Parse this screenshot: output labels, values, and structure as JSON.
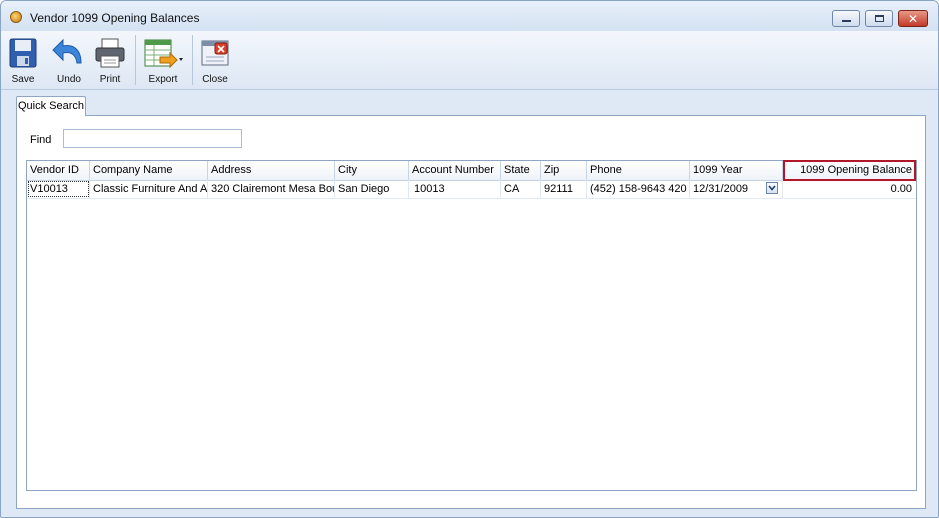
{
  "window": {
    "title": "Vendor 1099 Opening Balances"
  },
  "toolbar": {
    "save_label": "Save",
    "undo_label": "Undo",
    "print_label": "Print",
    "export_label": "Export",
    "close_label": "Close"
  },
  "tabs": [
    {
      "label": "Quick Search"
    }
  ],
  "search": {
    "find_label": "Find",
    "find_value": ""
  },
  "grid": {
    "columns": [
      "Vendor ID",
      "Company Name",
      "Address",
      "City",
      "Account Number",
      "State",
      "Zip",
      "Phone",
      "1099 Year",
      "1099 Opening Balance"
    ],
    "rows": [
      [
        "V10013",
        "Classic Furniture And Ap",
        "320 Clairemont Mesa Bou",
        "San Diego",
        "10013",
        "CA",
        "92111",
        "(452) 158-9643 420",
        "12/31/2009",
        "0.00"
      ]
    ]
  },
  "colors": {
    "highlight": "#b0182a",
    "accent": "#2f6fc4"
  }
}
